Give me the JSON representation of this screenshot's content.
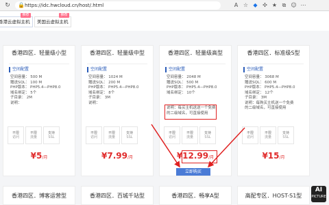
{
  "browser": {
    "url": "https://idc.hwcloud.cn/host/.html"
  },
  "tabs": [
    {
      "label": "香港云虚拟主机",
      "badge": "推荐"
    },
    {
      "label": "美国云虚拟主机",
      "badge": "推荐"
    }
  ],
  "plans": [
    {
      "title": "香港四区．轻量级小型",
      "section": "空间配置",
      "specs": [
        "空间容量：  500 M",
        "赠送SQL：  100 M",
        "PHP版本：  PHP5.4—PHP8.0",
        "域名绑定：  5个",
        "子目录：  2M",
        "说明："
      ],
      "note": [],
      "features": [
        {
          "top": "不限",
          "bottom": "访问"
        },
        {
          "top": "不限",
          "bottom": "流量"
        },
        {
          "top": "支持",
          "bottom": "SSL"
        }
      ],
      "price": "¥5",
      "unit": "/月"
    },
    {
      "title": "香港四区．轻量级中型",
      "section": "空间配置",
      "specs": [
        "空间容量：  1024 M",
        "赠送SQL：  200 M",
        "PHP版本：  PHP5.4—PHP8.0",
        "域名绑定：  8个",
        "子目录：  3M",
        "说明："
      ],
      "note": [],
      "features": [
        {
          "top": "不限",
          "bottom": "访问"
        },
        {
          "top": "不限",
          "bottom": "流量"
        },
        {
          "top": "支持",
          "bottom": "SSL"
        }
      ],
      "price": "¥7.99",
      "unit": "/月"
    },
    {
      "title": "香港四区．轻量级高型",
      "section": "空间配置",
      "specs": [
        "空间容量：  2048 M",
        "赠送SQL：  500 M",
        "PHP版本：  PHP5.4—PHP8.0",
        "域名绑定：  10个"
      ],
      "note": [
        "说明：每买主机送送一个免费",
        "的二级域名，可直接使用"
      ],
      "features": [
        {
          "top": "不限",
          "bottom": "访问"
        },
        {
          "top": "不限",
          "bottom": "流量"
        },
        {
          "top": "支持",
          "bottom": "SSL"
        }
      ],
      "price": "¥12.99",
      "unit": "/月",
      "cta": "立即购买"
    },
    {
      "title": "香港四区．标准级S型",
      "section": "空间配置",
      "specs": [
        "空间容量：  3068 M",
        "赠送SQL：  600 M",
        "PHP版本：  PHP5.4—PHP8.0",
        "域名绑定：  12个",
        "子目录：  3M"
      ],
      "note": [
        "说明：每购买主机送一个免费",
        "的二级域名，可直接使用"
      ],
      "features": [
        {
          "top": "不限",
          "bottom": "访问"
        },
        {
          "top": "不限",
          "bottom": "流量"
        },
        {
          "top": "支持",
          "bottom": "SSL"
        }
      ],
      "price": "¥15",
      "unit": "/月"
    }
  ],
  "bottom_plans": [
    "香港四区．博客运营型",
    "香港四区．百城千站型",
    "香港四区．畅享A型",
    "高配专区．HOST-S1型"
  ],
  "colors": {
    "accent": "#2b5cb8",
    "price": "#e02b2b",
    "highlight": "#e02020",
    "button": "#4a7bd6"
  },
  "watermark": {
    "main": "AI",
    "sub": "PICTURE"
  }
}
